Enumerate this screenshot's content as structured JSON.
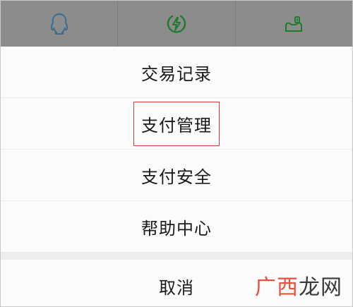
{
  "top_bar": {
    "icons": [
      "qq-icon",
      "lightning-icon",
      "game-icon"
    ],
    "colors": {
      "background": "#8c8c8c",
      "qq": "#3a6d8f",
      "lightning": "#1f7a2e",
      "game": "#1f7a2e"
    }
  },
  "menu": {
    "items": [
      {
        "label": "交易记录"
      },
      {
        "label": "支付管理",
        "highlighted": true
      },
      {
        "label": "支付安全"
      },
      {
        "label": "帮助中心"
      }
    ],
    "cancel_label": "取消",
    "highlight_color": "#e23c3c"
  },
  "watermark": {
    "part1": "广西",
    "part2": "龙网",
    "part1_color": "#e7513e"
  }
}
